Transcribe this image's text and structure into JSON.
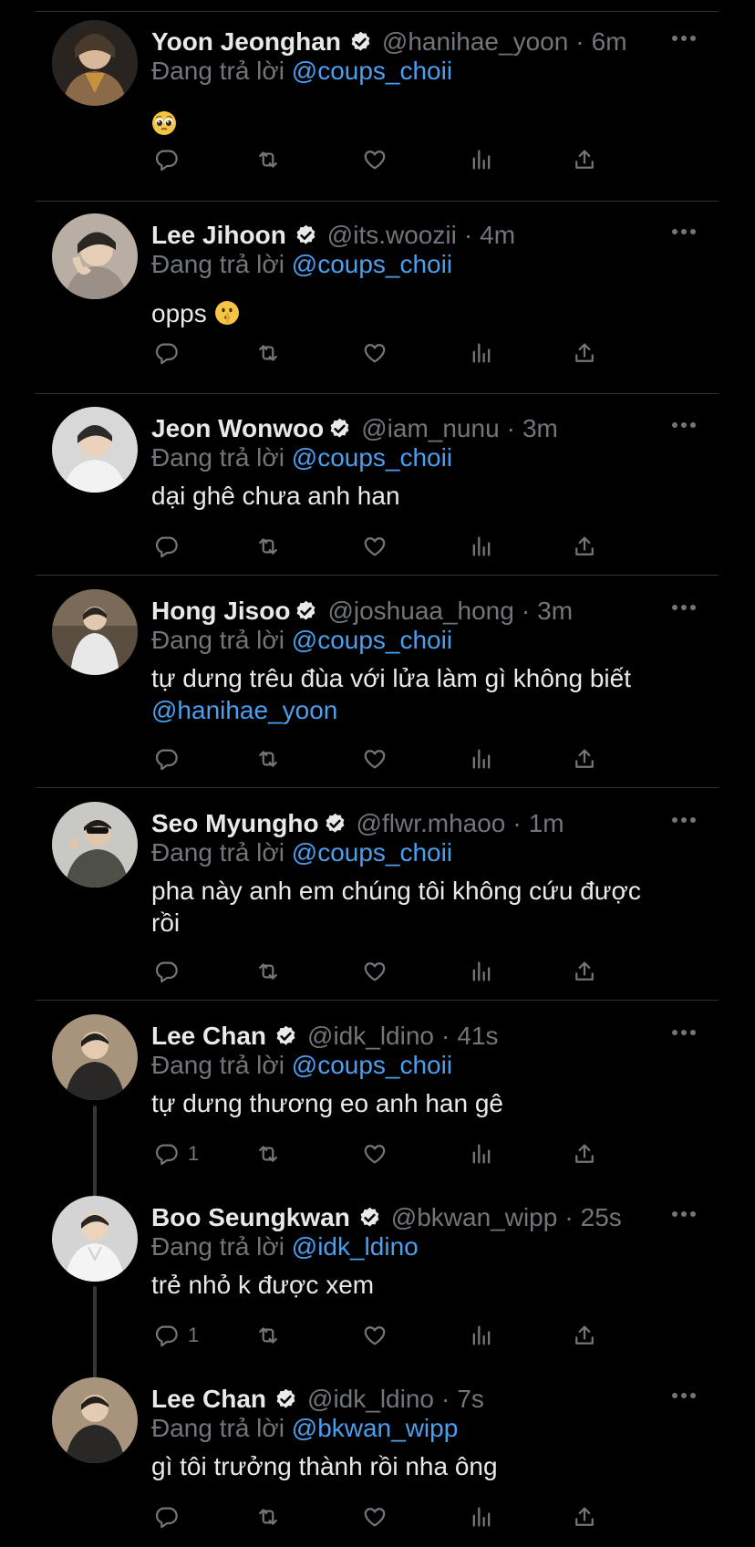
{
  "tweets": [
    {
      "name": "Yoon Jeonghan",
      "handle": "@hanihae_yoon",
      "time": "6m",
      "reply_prefix": "Đang trả lời",
      "reply_to": "@coups_choii",
      "text": "",
      "emoji": "pleading-face",
      "avatar_color": "#8a6a48",
      "reply_count": ""
    },
    {
      "name": "Lee Jihoon",
      "handle": "@its.woozii",
      "time": "4m",
      "reply_prefix": "Đang trả lời",
      "reply_to": "@coups_choii",
      "text": "opps ",
      "emoji": "shushing-face",
      "avatar_color": "#9a9088",
      "reply_count": ""
    },
    {
      "name": "Jeon Wonwoo",
      "handle": "@iam_nunu",
      "time": "3m",
      "reply_prefix": "Đang trả lời",
      "reply_to": "@coups_choii",
      "text": "dại ghê chưa anh han",
      "emoji": "",
      "avatar_color": "#c8c8c8",
      "reply_count": ""
    },
    {
      "name": "Hong Jisoo",
      "handle": "@joshuaa_hong",
      "time": "3m",
      "reply_prefix": "Đang trả lời",
      "reply_to": "@coups_choii",
      "text": "tự dưng trêu đùa với lửa làm gì không biết",
      "text_mention": "@hanihae_yoon",
      "emoji": "",
      "avatar_color": "#6b5a48",
      "reply_count": ""
    },
    {
      "name": "Seo Myungho",
      "handle": "@flwr.mhaoo",
      "time": "1m",
      "reply_prefix": "Đang trả lời",
      "reply_to": "@coups_choii",
      "text": "pha này anh em chúng tôi không cứu được rồi",
      "emoji": "",
      "avatar_color": "#5e6058",
      "reply_count": ""
    },
    {
      "name": "Lee Chan",
      "handle": "@idk_ldino",
      "time": "41s",
      "reply_prefix": "Đang trả lời",
      "reply_to": "@coups_choii",
      "text": "tự dưng thương eo anh han gê",
      "emoji": "",
      "avatar_color": "#7a6550",
      "reply_count": "1"
    },
    {
      "name": "Boo Seungkwan",
      "handle": "@bkwan_wipp",
      "time": "25s",
      "reply_prefix": "Đang trả lời",
      "reply_to": "@idk_ldino",
      "text": "trẻ nhỏ k được xem",
      "emoji": "",
      "avatar_color": "#d8d8d8",
      "reply_count": "1"
    },
    {
      "name": "Lee Chan",
      "handle": "@idk_ldino",
      "time": "7s",
      "reply_prefix": "Đang trả lời",
      "reply_to": "@bkwan_wipp",
      "text": "gì tôi trưởng thành rồi nha ông",
      "emoji": "",
      "avatar_color": "#7a6550",
      "reply_count": ""
    }
  ],
  "icons": {
    "more": "more-horizontal-icon",
    "reply": "reply-bubble-icon",
    "retweet": "retweet-icon",
    "like": "heart-icon",
    "views": "analytics-icon",
    "share": "share-icon",
    "verified": "verified-badge-icon"
  },
  "colors": {
    "background": "#000000",
    "text": "#e7e9ea",
    "muted": "#71767b",
    "mention": "#4a9ff0",
    "separator": "#2f3336"
  }
}
